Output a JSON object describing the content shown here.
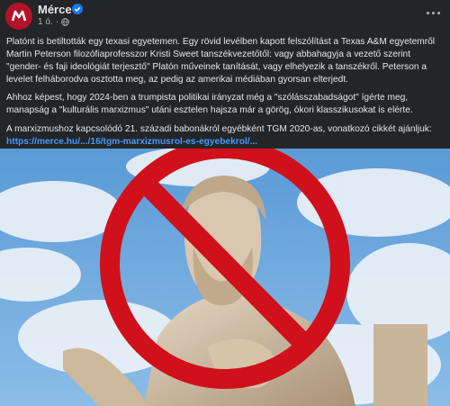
{
  "post": {
    "author": "Mérce",
    "time": "1 ó.",
    "text": {
      "p1": "Platónt is betiltották egy texasi egyetemen. Egy rövid levélben kapott felszólítást a Texas A&M egyetemről Martin Peterson filozófiaprofesszor Kristi Sweet tanszékvezetőtől: vagy abbahagyja a vezető szerint \"gender- és faji ideológiát terjesztő\" Platón műveinek tanítását, vagy elhelyezik a tanszékről. Peterson a levelet felháborodva osztotta meg, az pedig az amerikai médiában gyorsan elterjedt.",
      "p2": "Ahhoz képest, hogy 2024-ben a trumpista politikai irányzat még a \"szólásszabadságot\" ígérte meg, manapság a \"kulturális marxizmus\" utáni esztelen hajsza már a görög, ókori klasszikusokat is elérte.",
      "p3": "A marxizmushoz kapcsolódó 21. századi babonákról egyébként TGM 2020-as, vonatkozó cikkét ajánljuk:",
      "link": "https://merce.hu/.../16/tgm-marxizmusrol-es-egyebekrol/..."
    }
  },
  "icons": {
    "avatar": "merce-logo-icon",
    "verified": "verified-badge-icon",
    "audience": "globe-icon",
    "more": "more-options-icon"
  },
  "colors": {
    "background": "#242526",
    "text": "#e4e6eb",
    "secondary": "#b0b3b8",
    "link": "#4599ff",
    "verified": "#1877f2",
    "avatar": "#b2122a",
    "prohibition": "#d0101a"
  }
}
